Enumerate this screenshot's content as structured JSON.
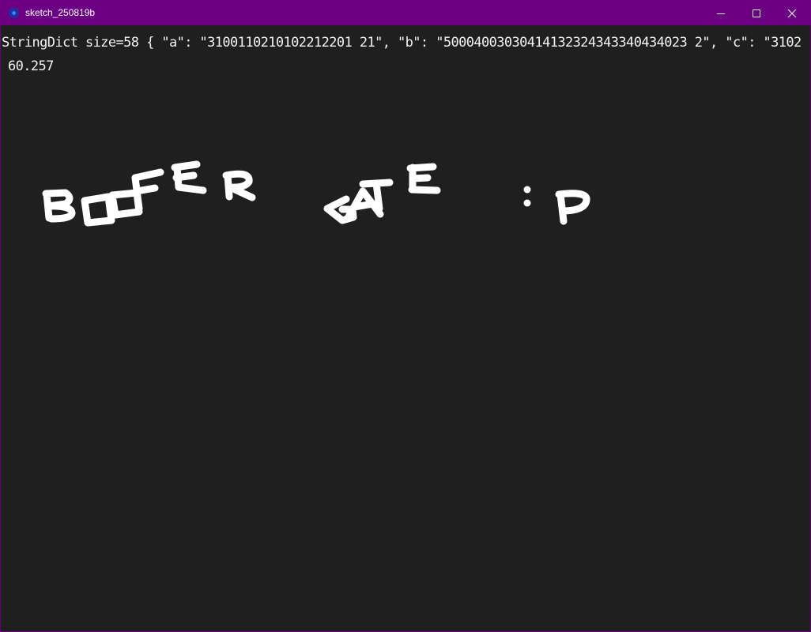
{
  "window": {
    "title": "sketch_250819b",
    "app_icon": "processing-app-icon",
    "controls": {
      "minimize_icon": "minimize-icon",
      "maximize_icon": "maximize-icon",
      "close_icon": "close-icon"
    },
    "colors": {
      "titlebar": "#6b0085",
      "canvas_background": "#1f1f1f",
      "text": "#ffffff"
    }
  },
  "canvas": {
    "console_lines": [
      "StringDict size=58 { \"a\": \"3100110210102212201 21\", \"b\": \"50004003030414132324343340434023 2\", \"c\": \"3102",
      "60.257"
    ],
    "drawn_words": [
      "BOOFER",
      "GATE",
      ":",
      "P"
    ]
  }
}
